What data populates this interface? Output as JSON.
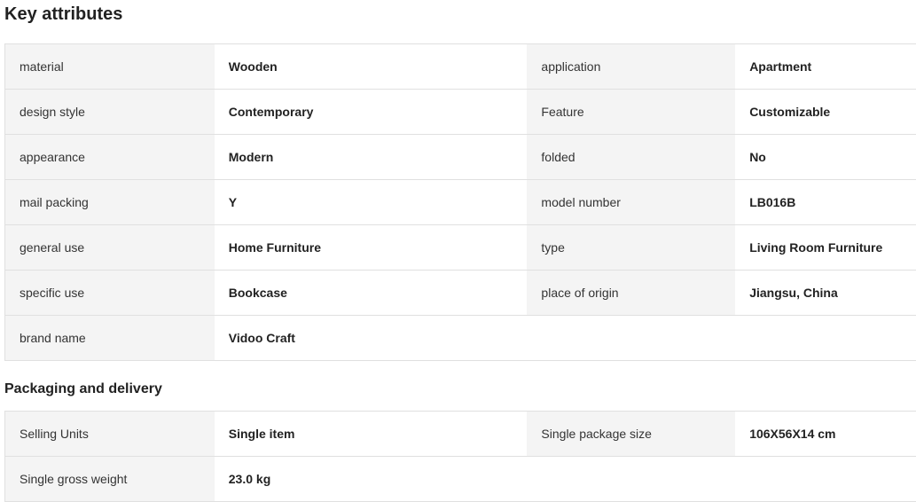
{
  "key_attributes": {
    "title": "Key attributes",
    "rows": [
      {
        "l1": "material",
        "v1": "Wooden",
        "l2": "application",
        "v2": "Apartment"
      },
      {
        "l1": "design style",
        "v1": "Contemporary",
        "l2": "Feature",
        "v2": "Customizable"
      },
      {
        "l1": "appearance",
        "v1": "Modern",
        "l2": "folded",
        "v2": "No"
      },
      {
        "l1": "mail packing",
        "v1": "Y",
        "l2": "model number",
        "v2": "LB016B"
      },
      {
        "l1": "general use",
        "v1": "Home Furniture",
        "l2": "type",
        "v2": "Living Room Furniture"
      },
      {
        "l1": "specific use",
        "v1": "Bookcase",
        "l2": "place of origin",
        "v2": "Jiangsu, China"
      },
      {
        "l1": "brand name",
        "v1": "Vidoo Craft"
      }
    ]
  },
  "packaging": {
    "title": "Packaging and delivery",
    "rows": [
      {
        "l1": "Selling Units",
        "v1": "Single item",
        "l2": "Single package size",
        "v2": "106X56X14 cm"
      },
      {
        "l1": "Single gross weight",
        "v1": "23.0 kg"
      }
    ]
  }
}
